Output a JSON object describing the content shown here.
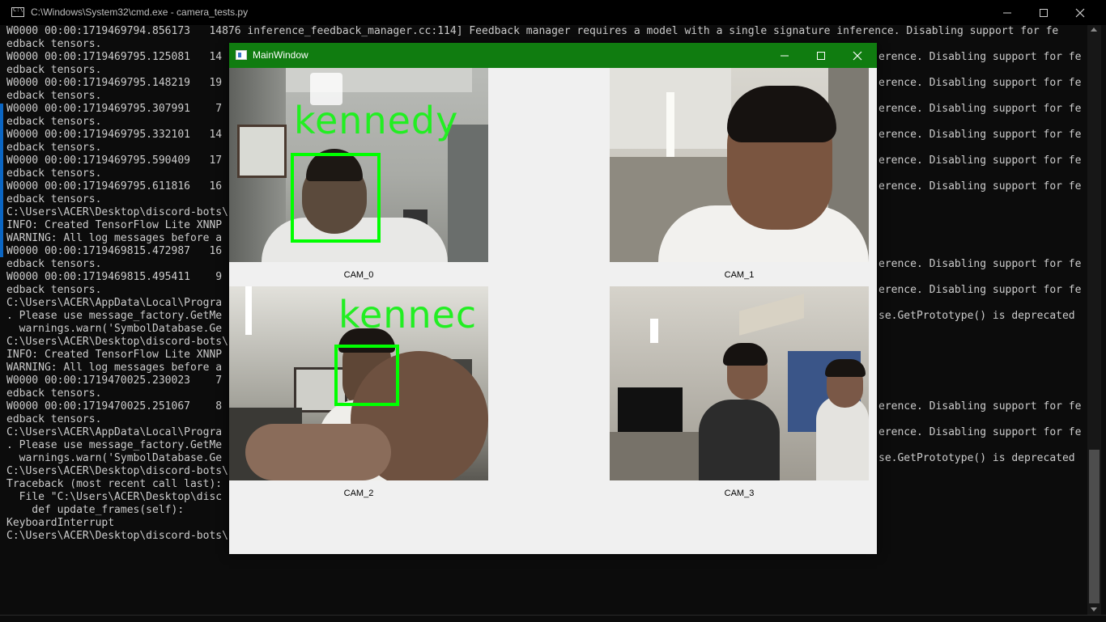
{
  "console": {
    "title": "C:\\Windows\\System32\\cmd.exe - camera_tests.py",
    "lines": [
      "W0000 00:00:1719469794.856173   14876 inference_feedback_manager.cc:114] Feedback manager requires a model with a single signature inference. Disabling support for fe",
      "edback tensors.",
      "W0000 00:00:1719469795.125081   14",
      "edback tensors.",
      "W0000 00:00:1719469795.148219   19",
      "edback tensors.",
      "W0000 00:00:1719469795.307991    7",
      "edback tensors.",
      "W0000 00:00:1719469795.332101   14",
      "edback tensors.",
      "W0000 00:00:1719469795.590409   17",
      "edback tensors.",
      "W0000 00:00:1719469795.611816   16",
      "edback tensors.",
      "",
      "C:\\Users\\ACER\\Desktop\\discord-bots\\",
      "INFO: Created TensorFlow Lite XNNP",
      "WARNING: All log messages before a",
      "W0000 00:00:1719469815.472987   16",
      "edback tensors.",
      "W0000 00:00:1719469815.495411    9",
      "edback tensors.",
      "C:\\Users\\ACER\\AppData\\Local\\Progra",
      ". Please use message_factory.GetMe",
      "  warnings.warn('SymbolDatabase.Ge",
      "",
      "C:\\Users\\ACER\\Desktop\\discord-bots\\",
      "INFO: Created TensorFlow Lite XNNP",
      "WARNING: All log messages before a",
      "W0000 00:00:1719470025.230023    7",
      "edback tensors.",
      "W0000 00:00:1719470025.251067    8",
      "edback tensors.",
      "C:\\Users\\ACER\\AppData\\Local\\Progra",
      ". Please use message_factory.GetMe",
      "  warnings.warn('SymbolDatabase.Ge",
      "",
      "C:\\Users\\ACER\\Desktop\\discord-bots\\",
      "Traceback (most recent call last):",
      "  File \"C:\\Users\\ACER\\Desktop\\disc",
      "    def update_frames(self):",
      "KeyboardInterrupt",
      "",
      "C:\\Users\\ACER\\Desktop\\discord-bots\\cctv-opencv-prototype>camera_tests.py"
    ],
    "right_column": [
      {
        "row": 2,
        "text": "erence. Disabling support for fe"
      },
      {
        "row": 4,
        "text": "erence. Disabling support for fe"
      },
      {
        "row": 6,
        "text": "erence. Disabling support for fe"
      },
      {
        "row": 8,
        "text": "erence. Disabling support for fe"
      },
      {
        "row": 10,
        "text": "erence. Disabling support for fe"
      },
      {
        "row": 12,
        "text": "erence. Disabling support for fe"
      },
      {
        "row": 18,
        "text": "erence. Disabling support for fe"
      },
      {
        "row": 20,
        "text": "erence. Disabling support for fe"
      },
      {
        "row": 22,
        "text": "se.GetPrototype() is deprecated"
      },
      {
        "row": 29,
        "text": "erence. Disabling support for fe"
      },
      {
        "row": 31,
        "text": "erence. Disabling support for fe"
      },
      {
        "row": 33,
        "text": "se.GetPrototype() is deprecated"
      }
    ]
  },
  "main_window": {
    "title": "MainWindow",
    "cameras": [
      {
        "label": "CAM_0",
        "detection": "kennedy"
      },
      {
        "label": "CAM_1",
        "detection": ""
      },
      {
        "label": "CAM_2",
        "detection": "kennec"
      },
      {
        "label": "CAM_3",
        "detection": ""
      }
    ]
  },
  "colors": {
    "console_bg": "#0c0c0c",
    "console_text": "#cccccc",
    "mainwindow_titlebar": "#107c10",
    "detection_box": "#00ff00"
  },
  "icons": {
    "minimize": "minimize-icon",
    "maximize": "maximize-icon",
    "close": "close-icon"
  }
}
